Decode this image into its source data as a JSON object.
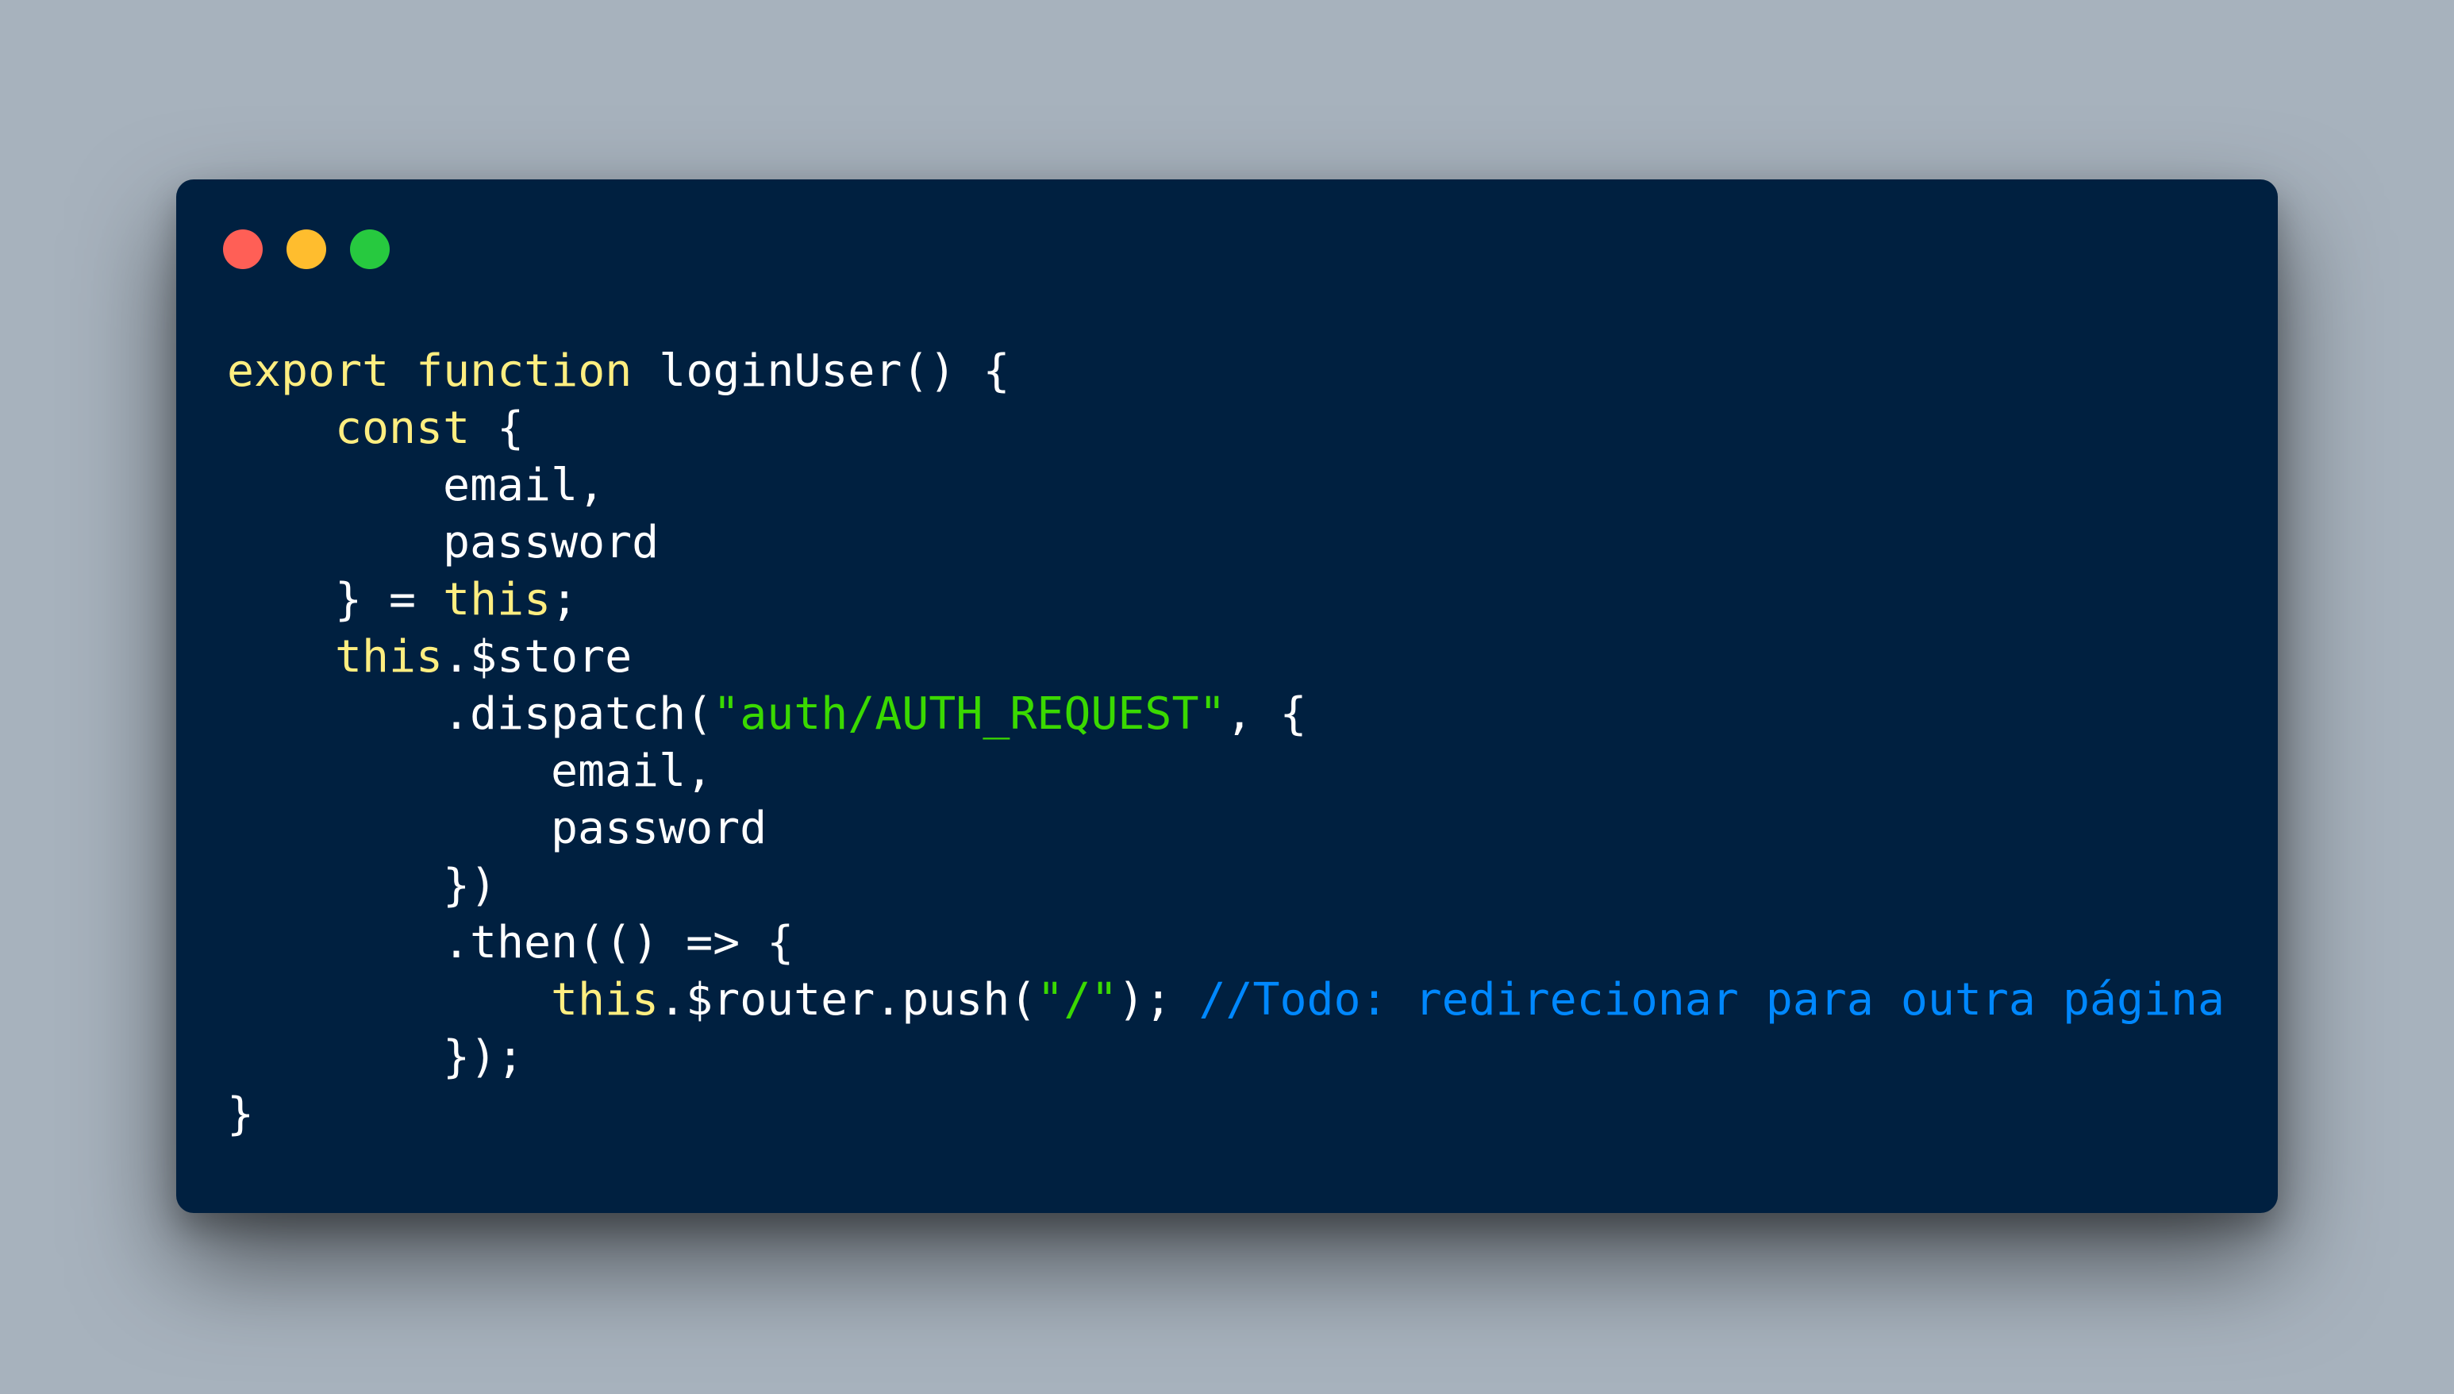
{
  "colors": {
    "background": "#a7b2bd",
    "window": "#002040",
    "close": "#ff5f56",
    "minimize": "#ffbd2e",
    "maximize": "#27c93f",
    "keyword": "#ffee80",
    "plain": "#ffffff",
    "string": "#3ad900",
    "comment": "#0088ff"
  },
  "window_controls": {
    "close_icon": "red-circle",
    "minimize_icon": "yellow-circle",
    "maximize_icon": "green-circle"
  },
  "code": {
    "lines": [
      {
        "indent": 0,
        "tokens": [
          {
            "text": "export",
            "type": "keyword"
          },
          {
            "text": " ",
            "type": "plain"
          },
          {
            "text": "function",
            "type": "keyword"
          },
          {
            "text": " loginUser() {",
            "type": "plain"
          }
        ]
      },
      {
        "indent": 1,
        "tokens": [
          {
            "text": "const",
            "type": "keyword"
          },
          {
            "text": " {",
            "type": "plain"
          }
        ]
      },
      {
        "indent": 2,
        "tokens": [
          {
            "text": "email,",
            "type": "plain"
          }
        ]
      },
      {
        "indent": 2,
        "tokens": [
          {
            "text": "password",
            "type": "plain"
          }
        ]
      },
      {
        "indent": 1,
        "tokens": [
          {
            "text": "} = ",
            "type": "plain"
          },
          {
            "text": "this",
            "type": "keyword"
          },
          {
            "text": ";",
            "type": "plain"
          }
        ]
      },
      {
        "indent": 1,
        "tokens": [
          {
            "text": "this",
            "type": "keyword"
          },
          {
            "text": ".$store",
            "type": "plain"
          }
        ]
      },
      {
        "indent": 2,
        "tokens": [
          {
            "text": ".dispatch(",
            "type": "plain"
          },
          {
            "text": "\"auth/AUTH_REQUEST\"",
            "type": "string"
          },
          {
            "text": ", {",
            "type": "plain"
          }
        ]
      },
      {
        "indent": 3,
        "tokens": [
          {
            "text": "email,",
            "type": "plain"
          }
        ]
      },
      {
        "indent": 3,
        "tokens": [
          {
            "text": "password",
            "type": "plain"
          }
        ]
      },
      {
        "indent": 2,
        "tokens": [
          {
            "text": "})",
            "type": "plain"
          }
        ]
      },
      {
        "indent": 2,
        "tokens": [
          {
            "text": ".then(() => {",
            "type": "plain"
          }
        ]
      },
      {
        "indent": 3,
        "tokens": [
          {
            "text": "this",
            "type": "keyword"
          },
          {
            "text": ".$router.push(",
            "type": "plain"
          },
          {
            "text": "\"/\"",
            "type": "string"
          },
          {
            "text": "); ",
            "type": "plain"
          },
          {
            "text": "//Todo: redirecionar para outra página",
            "type": "comment"
          }
        ]
      },
      {
        "indent": 2,
        "tokens": [
          {
            "text": "});",
            "type": "plain"
          }
        ]
      },
      {
        "indent": 0,
        "tokens": [
          {
            "text": "}",
            "type": "plain"
          }
        ]
      }
    ]
  }
}
